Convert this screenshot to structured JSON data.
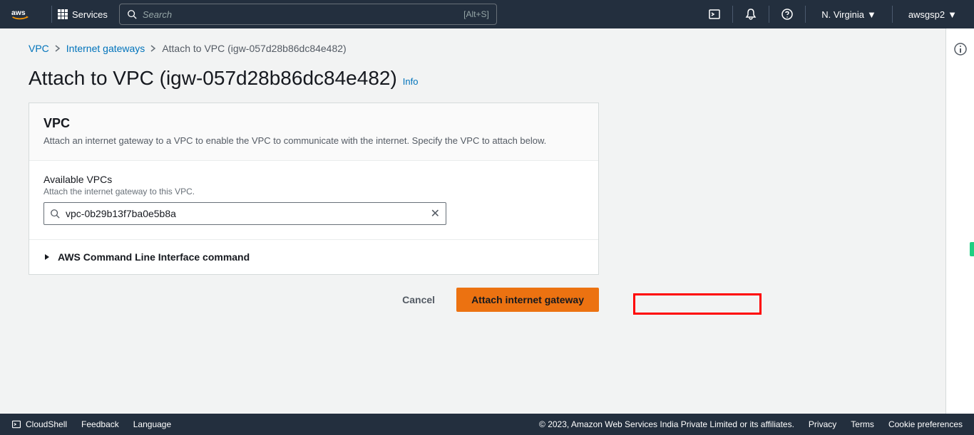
{
  "nav": {
    "services_label": "Services",
    "search_placeholder": "Search",
    "search_shortcut": "[Alt+S]",
    "region": "N. Virginia",
    "account": "awsgsp2"
  },
  "breadcrumb": {
    "root": "VPC",
    "mid": "Internet gateways",
    "current": "Attach to VPC (igw-057d28b86dc84e482)"
  },
  "page": {
    "title": "Attach to VPC (igw-057d28b86dc84e482)",
    "info_label": "Info"
  },
  "panel": {
    "header_title": "VPC",
    "header_desc": "Attach an internet gateway to a VPC to enable the VPC to communicate with the internet. Specify the VPC to attach below.",
    "field_label": "Available VPCs",
    "field_hint": "Attach the internet gateway to this VPC.",
    "search_value": "vpc-0b29b13f7ba0e5b8a",
    "cli_label": "AWS Command Line Interface command"
  },
  "actions": {
    "cancel": "Cancel",
    "submit": "Attach internet gateway"
  },
  "footer": {
    "cloudshell": "CloudShell",
    "feedback": "Feedback",
    "language": "Language",
    "copyright": "© 2023, Amazon Web Services India Private Limited or its affiliates.",
    "privacy": "Privacy",
    "terms": "Terms",
    "cookies": "Cookie preferences"
  }
}
